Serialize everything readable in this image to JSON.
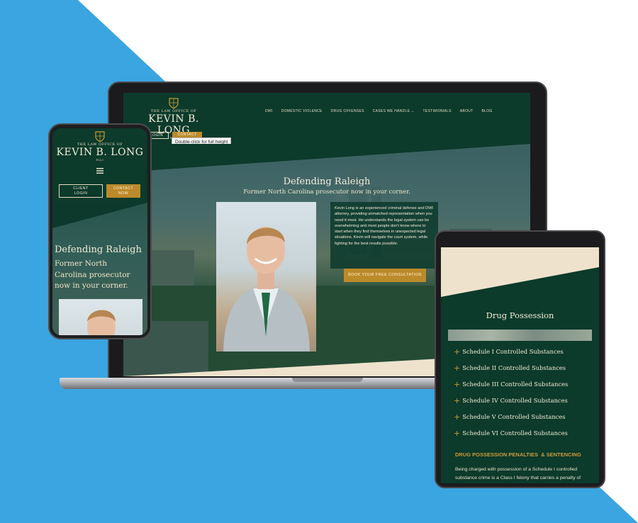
{
  "colors": {
    "background_blue": "#3aa5e0",
    "brand_green": "#0c3a2b",
    "brand_gold": "#bb8a2b",
    "cream": "#efe2cc"
  },
  "brand": {
    "small_line": "THE LAW OFFICE OF",
    "name": "KEVIN B. LONG",
    "suffix": "PLLC",
    "icon": "shield-icon"
  },
  "laptop": {
    "nav": [
      "DWI",
      "DOMESTIC VIOLENCE",
      "DRUG OFFENSES",
      "CASES WE HANDLE ⌄",
      "TESTIMONIALS",
      "ABOUT",
      "BLOG"
    ],
    "client_login": "LOGIN",
    "contact_now": "CONTACT NOW",
    "tooltip": "Double-click for full height",
    "hero_title": "Defending Raleigh",
    "hero_subtitle": "Former North Carolina prosecutor now in your corner.",
    "bio": "Kevin Long is an experienced criminal defense and DWI attorney, providing unmatched representation when you need it most. He understands the legal system can be overwhelming and most people don't know where to start when they find themselves in unexpected legal situations. Kevin will navigate the court system, while fighting for the best results possible.",
    "cta": "BOOK YOUR FREE CONSULTATION"
  },
  "phone": {
    "client_login": "CLIENT LOGIN",
    "contact_now": "CONTACT NOW",
    "menu_icon": "hamburger-icon",
    "hero_title": "Defending Raleigh",
    "hero_subtitle": "Former North Carolina prosecutor now in your corner."
  },
  "tablet": {
    "title": "Drug Possession",
    "items": [
      "Schedule I Controlled Substances",
      "Schedule II Controlled Substances",
      "Schedule III Controlled Substances",
      "Schedule IV Controlled Substances",
      "Schedule V Controlled Substances",
      "Schedule VI Controlled Substances"
    ],
    "penalties_heading": "DRUG POSSESSION PENALTIES  & SENTENCING",
    "penalties_text": "Being charged with possession of a Schedule I controlled substance crime is a Class I felony that carries a penalty of"
  }
}
